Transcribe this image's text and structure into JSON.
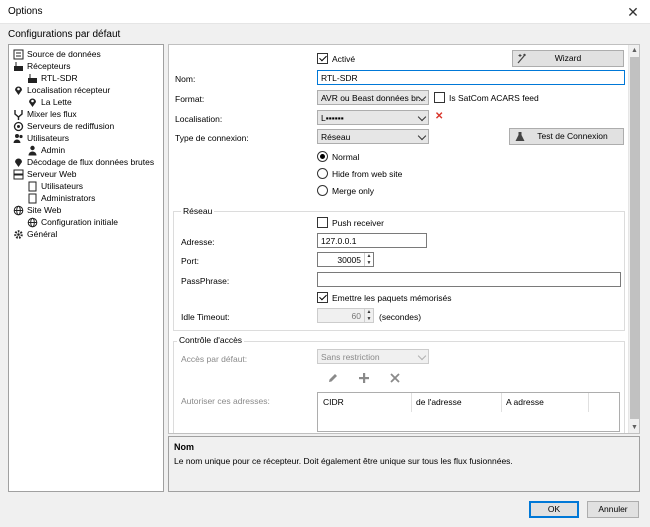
{
  "window": {
    "title": "Options",
    "close_glyph": "✕"
  },
  "subtitle": "Configurations par défaut",
  "tree": [
    {
      "label": "Source de données",
      "icon": "data-source-icon",
      "level": 0
    },
    {
      "label": "Récepteurs",
      "icon": "receivers-icon",
      "level": 0
    },
    {
      "label": "RTL-SDR",
      "icon": "receiver-device-icon",
      "level": 1
    },
    {
      "label": "Localisation récepteur",
      "icon": "location-pin-icon",
      "level": 0
    },
    {
      "label": "La Lette",
      "icon": "location-pin-icon",
      "level": 1
    },
    {
      "label": "Mixer les flux",
      "icon": "merge-icon",
      "level": 0
    },
    {
      "label": "Serveurs de rediffusion",
      "icon": "rebroadcast-icon",
      "level": 0
    },
    {
      "label": "Utilisateurs",
      "icon": "users-icon",
      "level": 0
    },
    {
      "label": "Admin",
      "icon": "user-icon",
      "level": 1
    },
    {
      "label": "Décodage de flux données brutes",
      "icon": "raw-feed-icon",
      "level": 0
    },
    {
      "label": "Serveur Web",
      "icon": "web-server-icon",
      "level": 0
    },
    {
      "label": "Utilisateurs",
      "icon": "document-icon",
      "level": 1
    },
    {
      "label": "Administrators",
      "icon": "document-icon",
      "level": 1
    },
    {
      "label": "Site Web",
      "icon": "globe-icon",
      "level": 0
    },
    {
      "label": "Configuration initiale",
      "icon": "globe-icon",
      "level": 1
    },
    {
      "label": "Général",
      "icon": "gear-icon",
      "level": 0
    }
  ],
  "form": {
    "active_label": "Activé",
    "active_checked": true,
    "wizard_label": "Wizard",
    "name_label": "Nom:",
    "name_value": "RTL-SDR",
    "format_label": "Format:",
    "format_value": "AVR ou Beast données br...",
    "satcom_label": "Is SatCom ACARS feed",
    "satcom_checked": false,
    "location_label": "Localisation:",
    "location_value": "L▪▪▪▪▪▪",
    "location_clear_glyph": "✕",
    "conn_type_label": "Type de connexion:",
    "conn_type_value": "Réseau",
    "test_conn_label": "Test de Connexion",
    "radio_options": [
      "Normal",
      "Hide from web site",
      "Merge only"
    ],
    "radio_selected": 0
  },
  "network": {
    "title": "Réseau",
    "push_label": "Push receiver",
    "push_checked": false,
    "address_label": "Adresse:",
    "address_value": "127.0.0.1",
    "port_label": "Port:",
    "port_value": "30005",
    "passphrase_label": "PassPhrase:",
    "passphrase_value": "",
    "send_stored_label": "Emettre les paquets mémorisés",
    "send_stored_checked": true,
    "idle_label": "Idle Timeout:",
    "idle_value": "60",
    "idle_unit": "(secondes)"
  },
  "access": {
    "title": "Contrôle d'accès",
    "default_label": "Accès par défaut:",
    "default_value": "Sans restriction",
    "allow_label": "Autoriser ces adresses:",
    "columns": [
      "CIDR",
      "de l'adresse",
      "A adresse"
    ]
  },
  "help": {
    "title": "Nom",
    "description": "Le nom unique pour ce récepteur. Doit également être unique sur tous les flux fusionnées."
  },
  "buttons": {
    "ok": "OK",
    "cancel": "Annuler"
  },
  "colors": {
    "accent": "#0078d7",
    "clear_red": "#d9352b"
  }
}
